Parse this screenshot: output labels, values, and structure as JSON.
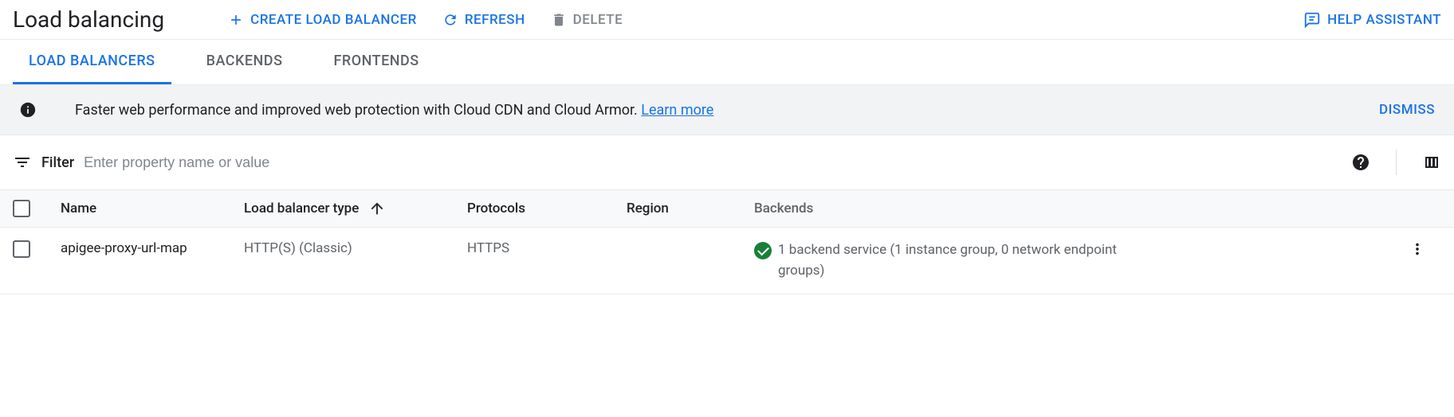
{
  "header": {
    "title": "Load balancing",
    "create_label": "CREATE LOAD BALANCER",
    "refresh_label": "REFRESH",
    "delete_label": "DELETE",
    "help_label": "HELP ASSISTANT"
  },
  "tabs": {
    "load_balancers": "LOAD BALANCERS",
    "backends": "BACKENDS",
    "frontends": "FRONTENDS"
  },
  "banner": {
    "text": "Faster web performance and improved web protection with Cloud CDN and Cloud Armor. ",
    "link": "Learn more",
    "dismiss": "DISMISS"
  },
  "filter": {
    "label": "Filter",
    "placeholder": "Enter property name or value"
  },
  "table": {
    "columns": {
      "name": "Name",
      "type": "Load balancer type",
      "protocols": "Protocols",
      "region": "Region",
      "backends": "Backends"
    },
    "rows": [
      {
        "name": "apigee-proxy-url-map",
        "type": "HTTP(S) (Classic)",
        "protocols": "HTTPS",
        "region": "",
        "backends": "1 backend service (1 instance group, 0 network endpoint groups)"
      }
    ]
  }
}
